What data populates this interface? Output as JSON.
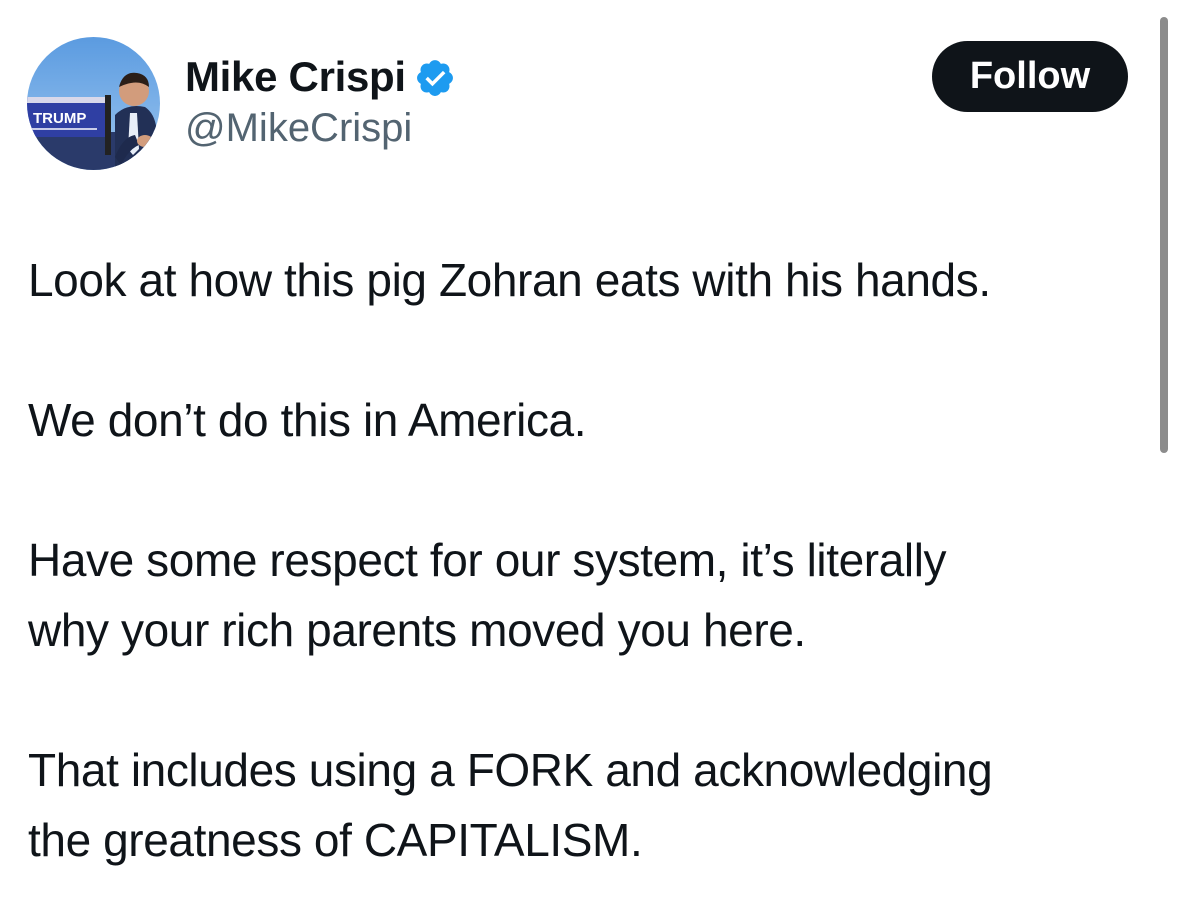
{
  "author": {
    "display_name": "Mike Crispi",
    "handle": "@MikeCrispi",
    "verified_icon": "verified-badge-icon",
    "avatar": {
      "sign_text": "TRUMP"
    }
  },
  "follow_button": {
    "label": "Follow"
  },
  "tweet": {
    "paragraphs": [
      "Look at how this pig Zohran eats with his hands.",
      "We don’t do this in America.",
      "Have some respect for our system, it’s literally\nwhy your rich parents moved you here.",
      "That includes using a FORK and acknowledging\nthe greatness of CAPITALISM."
    ]
  },
  "colors": {
    "text_primary": "#0f1419",
    "text_secondary": "#536471",
    "verified_blue": "#1d9bf0",
    "button_bg": "#0f1419",
    "button_text": "#ffffff"
  }
}
